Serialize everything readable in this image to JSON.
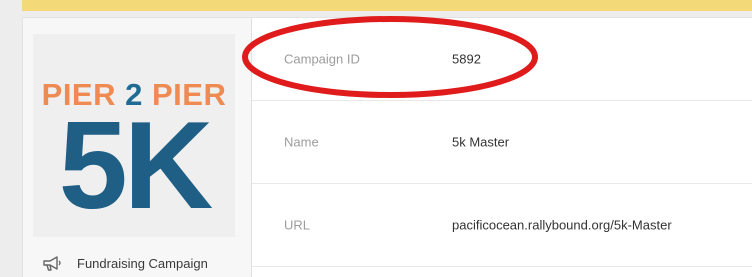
{
  "colors": {
    "accent_bar": "#f3d978",
    "logo_orange": "#ef8a52",
    "logo_blue": "#1f5f85",
    "annotation": "#e01b1b"
  },
  "logo": {
    "word1": "PIER",
    "number": "2",
    "word2": "PIER",
    "big_text": "5K"
  },
  "sidebar": {
    "item": {
      "icon": "megaphone-icon",
      "label": "Fundraising Campaign"
    }
  },
  "details": [
    {
      "label": "Campaign ID",
      "value": "5892"
    },
    {
      "label": "Name",
      "value": "5k Master"
    },
    {
      "label": "URL",
      "value": "pacificocean.rallybound.org/5k-Master"
    }
  ]
}
